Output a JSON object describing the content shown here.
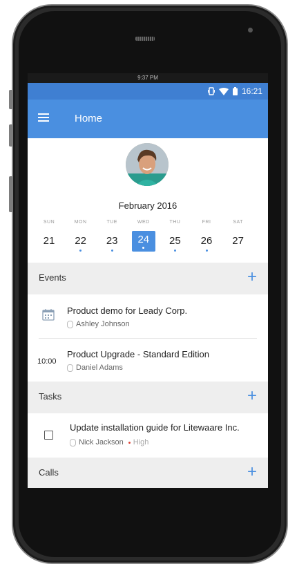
{
  "device": {
    "carrier_text": "9:37 PM"
  },
  "status_bar": {
    "time": "16:21",
    "icons": [
      "vibrate-icon",
      "wifi-icon",
      "battery-icon"
    ]
  },
  "app_bar": {
    "title": "Home",
    "menu_icon": "hamburger-menu-icon"
  },
  "calendar": {
    "month": "February 2016",
    "days": [
      {
        "name": "SUN",
        "num": "21",
        "has_event": false
      },
      {
        "name": "MON",
        "num": "22",
        "has_event": true
      },
      {
        "name": "TUE",
        "num": "23",
        "has_event": true
      },
      {
        "name": "WED",
        "num": "24",
        "has_event": true,
        "selected": true
      },
      {
        "name": "THU",
        "num": "25",
        "has_event": true
      },
      {
        "name": "FRI",
        "num": "26",
        "has_event": true
      },
      {
        "name": "SAT",
        "num": "27",
        "has_event": false
      }
    ]
  },
  "events": {
    "title": "Events",
    "items": [
      {
        "icon": "calendar-icon",
        "title": "Product demo for Leady Corp.",
        "person": "Ashley Johnson"
      },
      {
        "time": "10:00",
        "title": "Product Upgrade - Standard Edition",
        "person": "Daniel Adams"
      }
    ]
  },
  "tasks": {
    "title": "Tasks",
    "items": [
      {
        "title": "Update installation guide for Litewaare Inc.",
        "person": "Nick Jackson",
        "priority": "High"
      }
    ]
  },
  "calls": {
    "title": "Calls"
  },
  "colors": {
    "primary": "#4a8fe0",
    "status_bar": "#3f7fd2",
    "section_bg": "#eeeeee",
    "priority": "#e0463a"
  }
}
